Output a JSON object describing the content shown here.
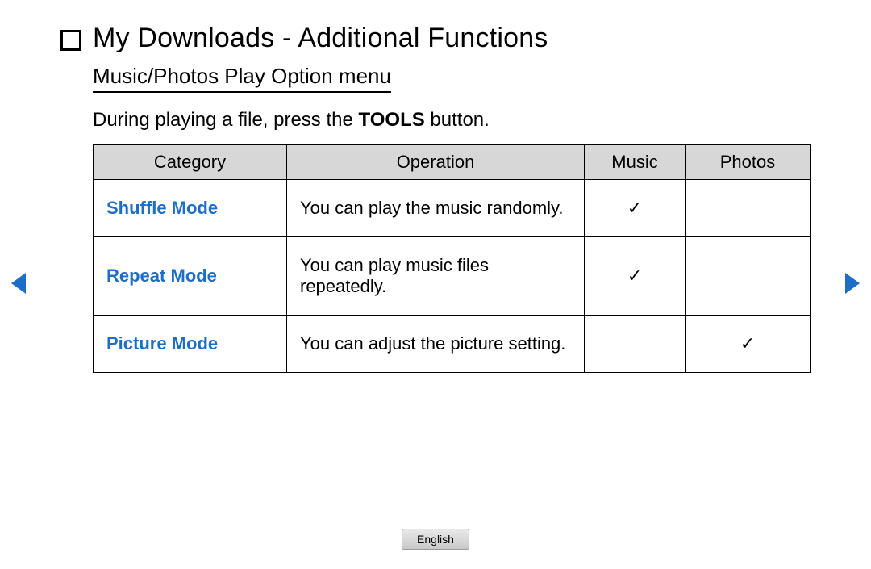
{
  "title": "My Downloads - Additional Functions",
  "subheading": "Music/Photos Play Option menu",
  "intro_pre": "During playing a file, press the ",
  "intro_bold": "TOOLS",
  "intro_post": " button.",
  "table": {
    "headers": {
      "category": "Category",
      "operation": "Operation",
      "music": "Music",
      "photos": "Photos"
    },
    "rows": [
      {
        "category": "Shuffle Mode",
        "operation": "You can play the music randomly.",
        "music": "✓",
        "photos": ""
      },
      {
        "category": "Repeat Mode",
        "operation": "You can play music files repeatedly.",
        "music": "✓",
        "photos": ""
      },
      {
        "category": "Picture Mode",
        "operation": "You can adjust the picture setting.",
        "music": "",
        "photos": "✓"
      }
    ]
  },
  "language": "English"
}
